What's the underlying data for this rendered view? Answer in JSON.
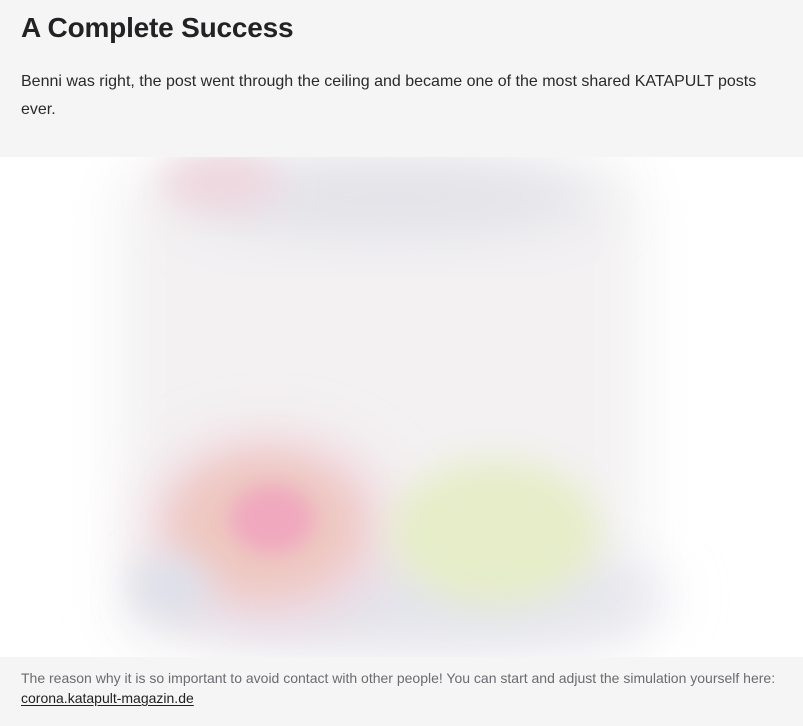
{
  "article": {
    "heading": "A Complete Success",
    "lead": "Benni was right, the post went through the ceiling and became one of the most shared KATAPULT posts ever."
  },
  "figure": {
    "caption_text": "The reason why it is so important to avoid contact with other people! You can start and adjust the simulation yourself here: ",
    "caption_link": "corona.katapult-magazin.de"
  },
  "colors": {
    "page_background": "#f5f5f6",
    "heading_text": "#222225",
    "caption_text": "#6b6b70",
    "blob_pink": "#f0a8bf",
    "blob_salmon": "#eec7c0",
    "blob_lime": "#e6edc8",
    "blob_blue_gray": "#dde0ea"
  }
}
